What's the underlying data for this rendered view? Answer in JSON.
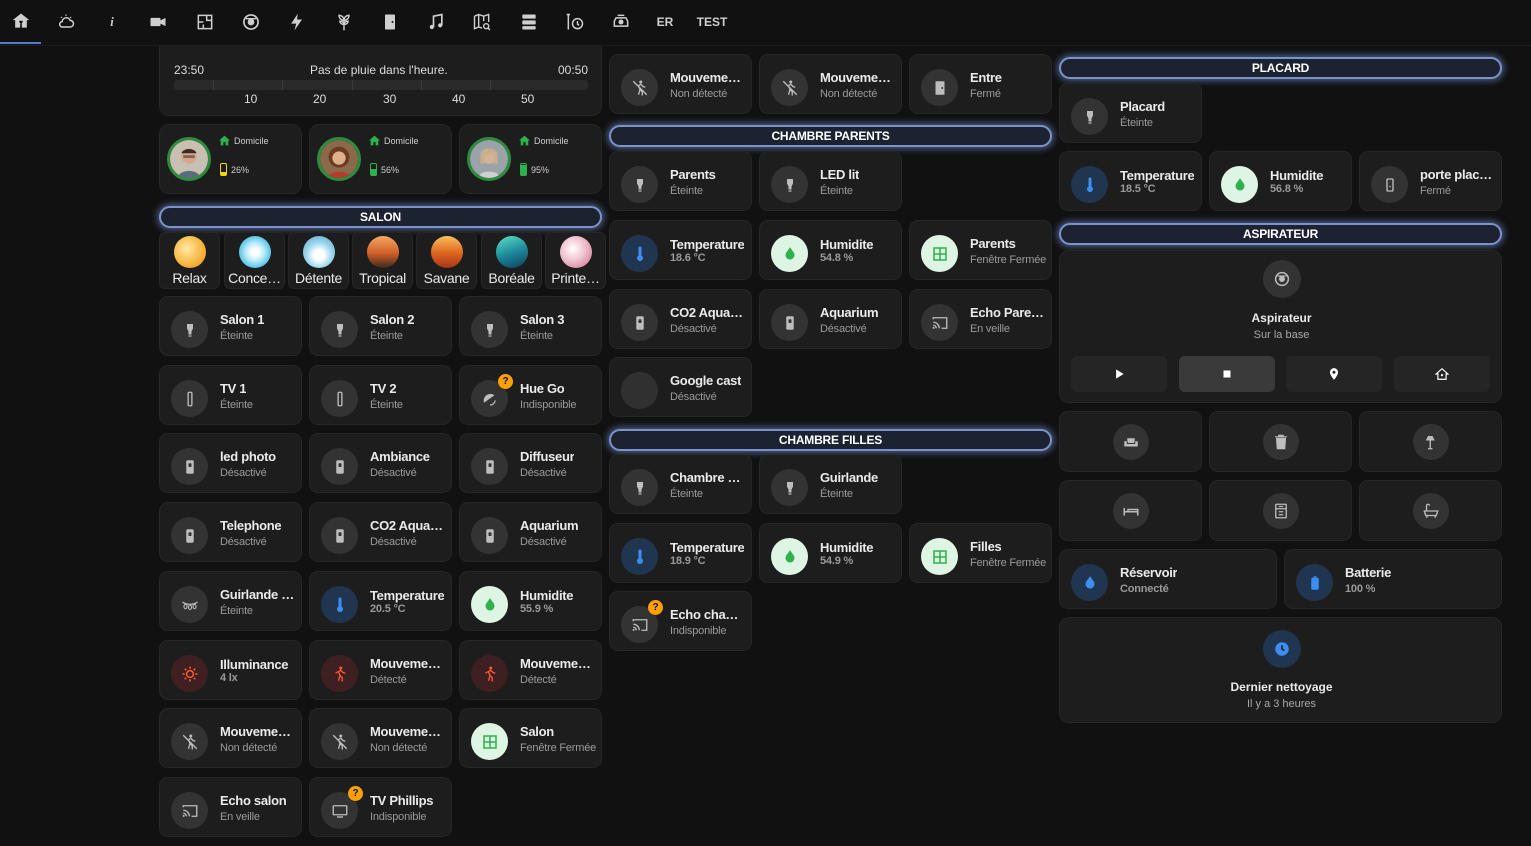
{
  "topbar": {
    "tabs": [
      {
        "icon": "home-heart-icon",
        "active": true
      },
      {
        "icon": "weather-cloud-icon"
      },
      {
        "icon": "info-icon"
      },
      {
        "icon": "video-camera-icon"
      },
      {
        "icon": "floor-plan-icon"
      },
      {
        "icon": "robot-vacuum-icon"
      },
      {
        "icon": "lightning-icon"
      },
      {
        "icon": "plant-icon"
      },
      {
        "icon": "door-icon"
      },
      {
        "icon": "music-note-icon"
      },
      {
        "icon": "map-search-icon"
      },
      {
        "icon": "server-icon"
      },
      {
        "icon": "timer-icon"
      },
      {
        "icon": "printer-icon"
      },
      {
        "label": "ER"
      },
      {
        "label": "TEST"
      }
    ]
  },
  "rain": {
    "start": "23:50",
    "end": "00:50",
    "text": "Pas de pluie dans l'heure.",
    "ticks": [
      "10",
      "20",
      "30",
      "40",
      "50"
    ]
  },
  "persons": [
    {
      "location": "Domicile",
      "battery": "26%",
      "battery_color": "#f4d70b"
    },
    {
      "location": "Domicile",
      "battery": "56%",
      "battery_color": "#2bb24c"
    },
    {
      "location": "Domicile",
      "battery": "95%",
      "battery_color": "#2bb24c"
    }
  ],
  "headers": {
    "salon": "SALON",
    "chambre_parents": "CHAMBRE PARENTS",
    "chambre_filles": "CHAMBRE FILLES",
    "placard": "PLACARD",
    "aspirateur": "ASPIRATEUR"
  },
  "scenes": [
    "Relax",
    "Conce…",
    "Détente",
    "Tropical",
    "Savane",
    "Boréale",
    "Printe…"
  ],
  "salon": [
    {
      "name": "Salon 1",
      "state": "Éteinte",
      "icon": "bulb-icon"
    },
    {
      "name": "Salon 2",
      "state": "Éteinte",
      "icon": "bulb-icon"
    },
    {
      "name": "Salon 3",
      "state": "Éteinte",
      "icon": "bulb-icon"
    },
    {
      "name": "TV 1",
      "state": "Éteinte",
      "icon": "lamp-tube-icon"
    },
    {
      "name": "TV 2",
      "state": "Éteinte",
      "icon": "lamp-tube-icon"
    },
    {
      "name": "Hue Go",
      "state": "Indisponible",
      "icon": "hue-go-icon"
    },
    {
      "name": "led photo",
      "state": "Désactivé",
      "icon": "plug-icon"
    },
    {
      "name": "Ambiance",
      "state": "Désactivé",
      "icon": "plug-icon"
    },
    {
      "name": "Diffuseur",
      "state": "Désactivé",
      "icon": "plug-icon"
    },
    {
      "name": "Telephone",
      "state": "Désactivé",
      "icon": "plug-icon"
    },
    {
      "name": "CO2 Aqua…",
      "state": "Désactivé",
      "icon": "plug-icon"
    },
    {
      "name": "Aquarium",
      "state": "Désactivé",
      "icon": "plug-icon"
    },
    {
      "name": "Guirlande …",
      "state": "Éteinte",
      "icon": "string-lights-icon"
    },
    {
      "name": "Temperature",
      "state": "20.5 °C",
      "icon": "thermometer-icon"
    },
    {
      "name": "Humidite",
      "state": "55.9 %",
      "icon": "water-drop-icon"
    },
    {
      "name": "Illuminance",
      "state": "4 lx",
      "icon": "sun-icon"
    },
    {
      "name": "Mouveme…",
      "state": "Détecté",
      "icon": "motion-icon"
    },
    {
      "name": "Mouveme…",
      "state": "Détecté",
      "icon": "motion-icon"
    },
    {
      "name": "Mouveme…",
      "state": "Non détecté",
      "icon": "motion-off-icon"
    },
    {
      "name": "Mouveme…",
      "state": "Non détecté",
      "icon": "motion-off-icon"
    },
    {
      "name": "Salon",
      "state": "Fenêtre Fermée",
      "icon": "window-icon"
    },
    {
      "name": "Echo salon",
      "state": "En veille",
      "icon": "cast-icon"
    },
    {
      "name": "TV Phillips",
      "state": "Indisponible",
      "icon": "tv-icon"
    }
  ],
  "col2_top": [
    {
      "name": "Mouveme…",
      "state": "Non détecté",
      "icon": "motion-off-icon"
    },
    {
      "name": "Mouveme…",
      "state": "Non détecté",
      "icon": "motion-off-icon"
    },
    {
      "name": "Entre",
      "state": "Fermé",
      "icon": "door-icon"
    }
  ],
  "parents": [
    {
      "name": "Parents",
      "state": "Éteinte",
      "icon": "bulb-icon"
    },
    {
      "name": "LED lit",
      "state": "Éteinte",
      "icon": "bulb-icon"
    },
    {
      "name": "Temperature",
      "state": "18.6 °C",
      "icon": "thermometer-icon"
    },
    {
      "name": "Humidite",
      "state": "54.8 %",
      "icon": "water-drop-icon"
    },
    {
      "name": "Parents",
      "state": "Fenêtre Fermée",
      "icon": "window-icon"
    },
    {
      "name": "CO2 Aqua…",
      "state": "Désactivé",
      "icon": "plug-icon"
    },
    {
      "name": "Aquarium",
      "state": "Désactivé",
      "icon": "plug-icon"
    },
    {
      "name": "Echo Pare…",
      "state": "En veille",
      "icon": "cast-icon"
    },
    {
      "name": "Google cast",
      "state": "Désactivé",
      "icon": "cast-icon"
    }
  ],
  "filles": [
    {
      "name": "Chambre …",
      "state": "Éteinte",
      "icon": "bulb-icon"
    },
    {
      "name": "Guirlande",
      "state": "Éteinte",
      "icon": "bulb-icon"
    },
    {
      "name": "Temperature",
      "state": "18.9 °C",
      "icon": "thermometer-icon"
    },
    {
      "name": "Humidite",
      "state": "54.9 %",
      "icon": "water-drop-icon"
    },
    {
      "name": "Filles",
      "state": "Fenêtre Fermée",
      "icon": "window-icon"
    },
    {
      "name": "Echo cha…",
      "state": "Indisponible",
      "icon": "cast-icon"
    }
  ],
  "placard": [
    {
      "name": "Placard",
      "state": "Éteinte",
      "icon": "bulb-icon"
    },
    {
      "name": "Temperature",
      "state": "18.5 °C",
      "icon": "thermometer-icon"
    },
    {
      "name": "Humidite",
      "state": "56.8 %",
      "icon": "water-drop-icon"
    },
    {
      "name": "porte plac…",
      "state": "Fermé",
      "icon": "door-sensor-icon"
    }
  ],
  "vacuum": {
    "name": "Aspirateur",
    "state": "Sur la base",
    "rooms": [
      "sofa-icon",
      "trash-icon",
      "floor-lamp-icon",
      "bed-icon",
      "wardrobe-icon",
      "bathtub-icon"
    ],
    "reservoir": {
      "name": "Réservoir",
      "state": "Connecté"
    },
    "battery": {
      "name": "Batterie",
      "state": "100 %"
    },
    "last_clean": {
      "name": "Dernier nettoyage",
      "state": "Il y a 3 heures"
    }
  }
}
